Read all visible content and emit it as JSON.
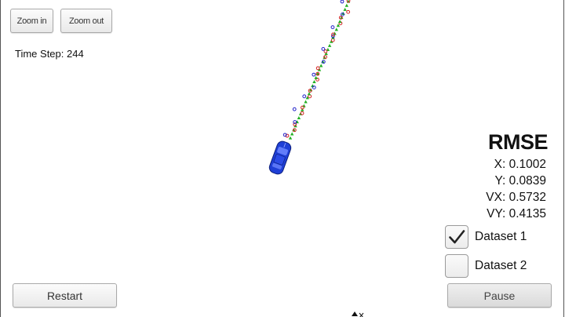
{
  "toolbar": {
    "zoom_in_label": "Zoom in",
    "zoom_out_label": "Zoom out"
  },
  "status": {
    "time_step_label": "Time Step:",
    "time_step_value": "244"
  },
  "rmse": {
    "title": "RMSE",
    "x": "X: 0.1002",
    "y": "Y: 0.0839",
    "vx": "VX: 0.5732",
    "vy": "VY: 0.4135"
  },
  "datasets": [
    {
      "label": "Dataset 1",
      "checked": true
    },
    {
      "label": "Dataset 2",
      "checked": false
    }
  ],
  "controls": {
    "restart_label": "Restart",
    "pause_label": "Pause"
  },
  "colors": {
    "car": "#1f3fd6",
    "estimate_marker": "#22b022",
    "lidar_marker": "#d42020",
    "radar_marker": "#2020c8"
  }
}
